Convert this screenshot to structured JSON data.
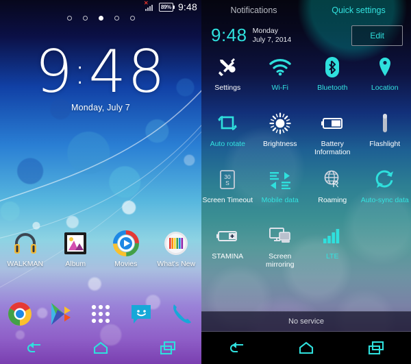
{
  "home": {
    "status_bar": {
      "signal_icon": "signal-bars-no-service-icon",
      "battery_percent": "89%",
      "time": "9:48"
    },
    "page_indicator": {
      "count": 5,
      "active_index": 2
    },
    "clock": {
      "hours": "9",
      "separator": ":",
      "minutes": "48",
      "date": "Monday, July 7"
    },
    "apps": [
      {
        "name": "walkman",
        "label": "WALKMAN",
        "icon": "headphones-icon"
      },
      {
        "name": "album",
        "label": "Album",
        "icon": "photo-frame-icon"
      },
      {
        "name": "movies",
        "label": "Movies",
        "icon": "play-circle-icon"
      },
      {
        "name": "whats-new",
        "label": "What's New",
        "icon": "color-bars-icon"
      }
    ],
    "dock": [
      {
        "name": "chrome",
        "icon": "chrome-icon"
      },
      {
        "name": "play-store",
        "icon": "play-store-icon"
      },
      {
        "name": "app-drawer",
        "icon": "app-drawer-grid-icon"
      },
      {
        "name": "messaging",
        "icon": "message-smiley-icon"
      },
      {
        "name": "phone",
        "icon": "phone-handset-icon"
      }
    ],
    "nav": [
      {
        "name": "back",
        "icon": "back-arrow-icon"
      },
      {
        "name": "home",
        "icon": "home-icon"
      },
      {
        "name": "recents",
        "icon": "recents-icon"
      }
    ]
  },
  "quick_settings": {
    "tabs": [
      {
        "label": "Notifications",
        "active": false
      },
      {
        "label": "Quick settings",
        "active": true
      }
    ],
    "clock": "9:48",
    "date_line1": "Monday",
    "date_line2": "July 7, 2014",
    "edit_label": "Edit",
    "tiles": [
      {
        "label": "Settings",
        "icon": "tools-icon",
        "state": "off"
      },
      {
        "label": "Wi-Fi",
        "icon": "wifi-icon",
        "state": "on"
      },
      {
        "label": "Bluetooth",
        "icon": "bluetooth-icon",
        "state": "on"
      },
      {
        "label": "Location",
        "icon": "location-pin-icon",
        "state": "on"
      },
      {
        "label": "Auto rotate",
        "icon": "auto-rotate-icon",
        "state": "on"
      },
      {
        "label": "Brightness",
        "icon": "brightness-sun-icon",
        "state": "off"
      },
      {
        "label": "Battery Information",
        "icon": "battery-icon",
        "state": "off"
      },
      {
        "label": "Flashlight",
        "icon": "flashlight-icon",
        "state": "off"
      },
      {
        "label": "Screen Timeout",
        "icon": "screen-timeout-icon",
        "state": "off"
      },
      {
        "label": "Mobile data",
        "icon": "mobile-data-icon",
        "state": "on"
      },
      {
        "label": "Roaming",
        "icon": "roaming-globe-icon",
        "state": "off"
      },
      {
        "label": "Auto-sync data",
        "icon": "sync-icon",
        "state": "on"
      },
      {
        "label": "STAMINA",
        "icon": "stamina-battery-icon",
        "state": "off"
      },
      {
        "label": "Screen mirroring",
        "icon": "screen-mirroring-icon",
        "state": "off"
      },
      {
        "label": "LTE",
        "icon": "lte-bars-icon",
        "state": "on"
      },
      {
        "label": "",
        "icon": "",
        "state": "empty"
      }
    ],
    "status_message": "No service",
    "nav": [
      {
        "name": "back",
        "icon": "back-arrow-icon"
      },
      {
        "name": "home",
        "icon": "home-icon"
      },
      {
        "name": "recents",
        "icon": "recents-icon"
      }
    ],
    "screen_timeout_value": "30 S"
  },
  "colors": {
    "accent_cyan": "#2fe0dd",
    "battery_red": "#e8352b",
    "tile_off": "#ffffff"
  }
}
